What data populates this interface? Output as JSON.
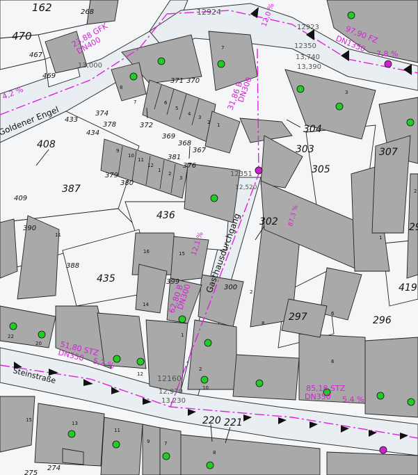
{
  "colors": {
    "building": "#a9a9a9",
    "street": "#e9eef2",
    "parcel_line": "#222222",
    "sewer": "#e020e0",
    "manhole_green": "#22cc22",
    "manhole_magenta": "#cc22cc"
  },
  "parcel_numbers": [
    {
      "id": "p162",
      "text": "162"
    },
    {
      "id": "p470",
      "text": "470"
    },
    {
      "id": "p467",
      "text": "467"
    },
    {
      "id": "p469",
      "text": "469"
    },
    {
      "id": "p268",
      "text": "268"
    },
    {
      "id": "p433",
      "text": "433"
    },
    {
      "id": "p434",
      "text": "434"
    },
    {
      "id": "p374",
      "text": "374"
    },
    {
      "id": "p378",
      "text": "378"
    },
    {
      "id": "p372",
      "text": "372"
    },
    {
      "id": "p371",
      "text": "371"
    },
    {
      "id": "p370",
      "text": "370"
    },
    {
      "id": "p369",
      "text": "369"
    },
    {
      "id": "p368",
      "text": "368"
    },
    {
      "id": "p367",
      "text": "367"
    },
    {
      "id": "p381",
      "text": "381"
    },
    {
      "id": "p376",
      "text": "376"
    },
    {
      "id": "p379",
      "text": "379"
    },
    {
      "id": "p380",
      "text": "380"
    },
    {
      "id": "p408",
      "text": "408"
    },
    {
      "id": "p387",
      "text": "387"
    },
    {
      "id": "p409",
      "text": "409"
    },
    {
      "id": "p390",
      "text": "390"
    },
    {
      "id": "p436",
      "text": "436"
    },
    {
      "id": "p388",
      "text": "388"
    },
    {
      "id": "p435",
      "text": "435"
    },
    {
      "id": "p399",
      "text": "399"
    },
    {
      "id": "p300",
      "text": "300"
    },
    {
      "id": "p302",
      "text": "302"
    },
    {
      "id": "p304",
      "text": "304"
    },
    {
      "id": "p303",
      "text": "303"
    },
    {
      "id": "p305",
      "text": "305"
    },
    {
      "id": "p307",
      "text": "307"
    },
    {
      "id": "p297",
      "text": "297"
    },
    {
      "id": "p296",
      "text": "296"
    },
    {
      "id": "p419",
      "text": "419"
    },
    {
      "id": "p29",
      "text": "29"
    },
    {
      "id": "p220",
      "text": "220"
    },
    {
      "id": "p221",
      "text": "221"
    },
    {
      "id": "p274",
      "text": "274"
    },
    {
      "id": "p275",
      "text": "275"
    }
  ],
  "house_numbers": [
    {
      "id": "h7a",
      "text": "7"
    },
    {
      "id": "h3a",
      "text": "3"
    },
    {
      "id": "h8a",
      "text": "8"
    },
    {
      "id": "h7b",
      "text": "7"
    },
    {
      "id": "h6a",
      "text": "6"
    },
    {
      "id": "h5a",
      "text": "5"
    },
    {
      "id": "h4a",
      "text": "4"
    },
    {
      "id": "h3b",
      "text": "3"
    },
    {
      "id": "h2a",
      "text": "2"
    },
    {
      "id": "h1a",
      "text": "1"
    },
    {
      "id": "h9a",
      "text": "9"
    },
    {
      "id": "h10a",
      "text": "10"
    },
    {
      "id": "h11a",
      "text": "11"
    },
    {
      "id": "h12a",
      "text": "12"
    },
    {
      "id": "h1b",
      "text": "1"
    },
    {
      "id": "h2b",
      "text": "2"
    },
    {
      "id": "h3c",
      "text": "3"
    },
    {
      "id": "h16a",
      "text": "16"
    },
    {
      "id": "h15a",
      "text": "15"
    },
    {
      "id": "h14a",
      "text": "14"
    },
    {
      "id": "h11b",
      "text": "11"
    },
    {
      "id": "h22a",
      "text": "22"
    },
    {
      "id": "h20a",
      "text": "20"
    },
    {
      "id": "h12b",
      "text": "12"
    },
    {
      "id": "h10b",
      "text": "10"
    },
    {
      "id": "h2c",
      "text": "2"
    },
    {
      "id": "h1c",
      "text": "1"
    },
    {
      "id": "h8b",
      "text": "8"
    },
    {
      "id": "h2d",
      "text": "2"
    },
    {
      "id": "h6b",
      "text": "6"
    },
    {
      "id": "h6c",
      "text": "6"
    },
    {
      "id": "h1d",
      "text": "1"
    },
    {
      "id": "h2e",
      "text": "2"
    },
    {
      "id": "h15b",
      "text": "15"
    },
    {
      "id": "h13a",
      "text": "13"
    },
    {
      "id": "h11c",
      "text": "11"
    },
    {
      "id": "h9b",
      "text": "9"
    },
    {
      "id": "h7c",
      "text": "7"
    },
    {
      "id": "h8c",
      "text": "8"
    }
  ],
  "street_names": [
    {
      "id": "s-engel",
      "text": "Goldener Engel"
    },
    {
      "id": "s-gasthaus",
      "text": "Gasthausdurchgang"
    },
    {
      "id": "s-stein",
      "text": "Steinstraße"
    }
  ],
  "sewer_labels": [
    {
      "id": "sw1",
      "text": "23,88 GFK"
    },
    {
      "id": "sw2",
      "text": "DN400"
    },
    {
      "id": "sw3",
      "text": "4,2 %"
    },
    {
      "id": "sw4",
      "text": "97,90 FZ"
    },
    {
      "id": "sw5",
      "text": "DN1350"
    },
    {
      "id": "sw6",
      "text": "7,8 %"
    },
    {
      "id": "sw7",
      "text": "31,86 B"
    },
    {
      "id": "sw8",
      "text": "DN300"
    },
    {
      "id": "sw9",
      "text": "62,80 B"
    },
    {
      "id": "sw10",
      "text": "DN300"
    },
    {
      "id": "sw11",
      "text": "12,1 %"
    },
    {
      "id": "sw12",
      "text": "51,80 STZ"
    },
    {
      "id": "sw13",
      "text": "DN350"
    },
    {
      "id": "sw14",
      "text": "5,2 %"
    },
    {
      "id": "sw15",
      "text": "85,18 STZ"
    },
    {
      "id": "sw16",
      "text": "DN350"
    },
    {
      "id": "sw17",
      "text": "5,4 %"
    },
    {
      "id": "sw18",
      "text": "87,3 %"
    },
    {
      "id": "sw19",
      "text": "12,0 %"
    }
  ],
  "elevation_labels": [
    {
      "id": "e1",
      "text": "12924"
    },
    {
      "id": "e2",
      "text": "12923"
    },
    {
      "id": "e3",
      "text": "12160"
    },
    {
      "id": "e4",
      "text": "12351"
    },
    {
      "id": "e5",
      "text": "12350"
    },
    {
      "id": "e6",
      "text": "13,740"
    },
    {
      "id": "e7",
      "text": "13,390"
    },
    {
      "id": "e8",
      "text": "12,970"
    },
    {
      "id": "e9",
      "text": "13,230"
    },
    {
      "id": "e10",
      "text": "12,520"
    },
    {
      "id": "e11",
      "text": "13,000"
    }
  ]
}
